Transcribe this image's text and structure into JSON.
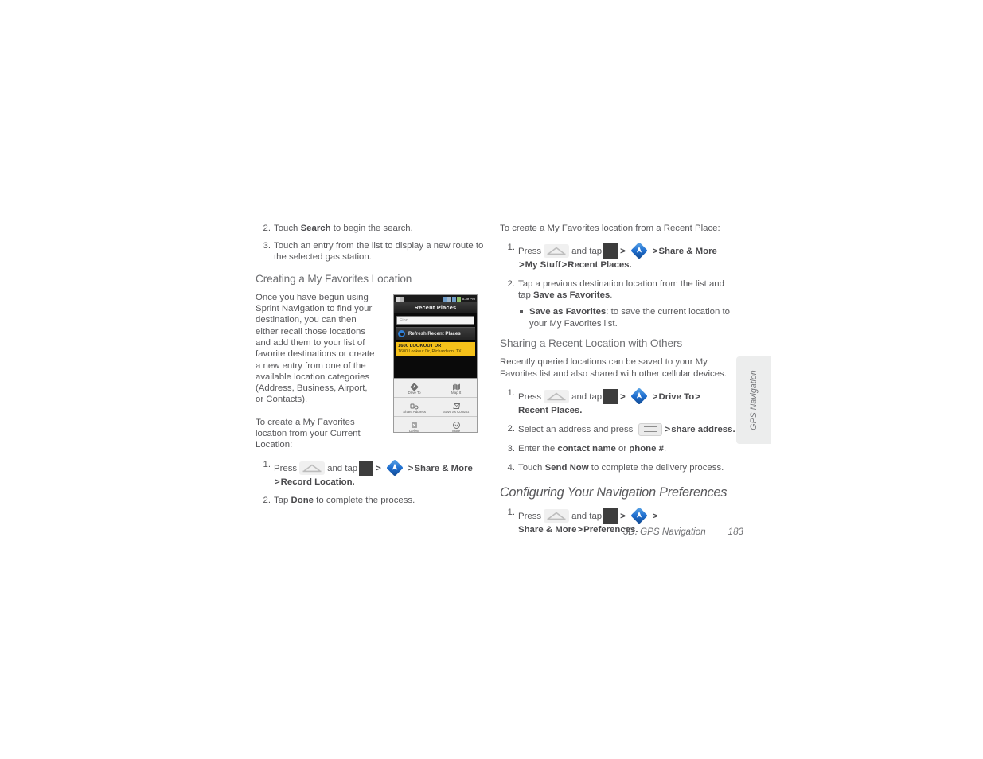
{
  "left_column": {
    "steps_top": [
      {
        "num": "2.",
        "pre": "Touch ",
        "strong": "Search",
        "post": " to begin the search."
      },
      {
        "num": "3.",
        "pre": "Touch an entry from the list to display a new route to the selected gas station.",
        "strong": "",
        "post": ""
      }
    ],
    "heading": "Creating a My Favorites Location",
    "paragraph": "Once you have begun using Sprint Navigation to find your destination, you can then either recall those locations and add them to your list of favorite destinations or create a new entry from one of the available location categories (Address, Business, Airport, or Contacts).",
    "intro2": "To create a My Favorites location from your Current Location:",
    "step1_press": "Press",
    "step1_andtap": "and tap",
    "step1_share": "Share & More",
    "step1_record": "Record Location.",
    "step2_num": "2.",
    "step2_pre": "Tap ",
    "step2_strong": "Done",
    "step2_post": " to complete the process.",
    "step1_num": "1."
  },
  "phone": {
    "status_time": "5:39 PM",
    "title": "Recent Places",
    "find_placeholder": "Find",
    "refresh_label": "Refresh Recent Places",
    "list_item_title": "1600 LOOKOUT DR",
    "list_item_sub": "1600 Lookout Dr, Richardson, TX...",
    "buttons": [
      {
        "label": "Drive To",
        "icon": "navigation-diamond-icon"
      },
      {
        "label": "Map It",
        "icon": "map-icon"
      },
      {
        "label": "Share Address",
        "icon": "share-icon"
      },
      {
        "label": "Save as Contact",
        "icon": "contact-card-icon"
      },
      {
        "label": "Delete",
        "icon": "delete-x-icon"
      },
      {
        "label": "More",
        "icon": "chevron-down-icon"
      }
    ]
  },
  "right_column": {
    "intro": "To create a My Favorites location from a Recent Place:",
    "step1_num": "1.",
    "step1_press": "Press",
    "step1_andtap": "and tap",
    "step1_share": "Share & More",
    "step1_mystuff": "My Stuff",
    "step1_recent": "Recent Places.",
    "step2_num": "2.",
    "step2_pre": "Tap a previous destination location from the list and tap ",
    "step2_strong": "Save as Favorites",
    "step2_post": ".",
    "sub_strong": "Save as Favorites",
    "sub_text": ": to save the current location to your My Favorites list.",
    "heading_sharing": "Sharing a Recent Location with Others",
    "sharing_paragraph": "Recently queried locations can be saved to your My Favorites list and also shared with other cellular devices.",
    "share_step1_num": "1.",
    "share_step1_press": "Press",
    "share_step1_andtap": "and tap",
    "share_step1_driveto": "Drive To",
    "share_step1_recent": "Recent Places.",
    "share_step2_num": "2.",
    "share_step2_pre": "Select an address and press ",
    "share_step2_share": "share address.",
    "share_step3_num": "3.",
    "share_step3_pre": "Enter the ",
    "share_step3_b1": "contact name",
    "share_step3_mid": " or ",
    "share_step3_b2": "phone #",
    "share_step3_post": ".",
    "share_step4_num": "4.",
    "share_step4_pre": "Touch ",
    "share_step4_b": "Send Now",
    "share_step4_post": " to complete the delivery process.",
    "heading_config": "Configuring Your Navigation Preferences",
    "cfg_step1_num": "1.",
    "cfg_step1_press": "Press",
    "cfg_step1_andtap": "and tap",
    "cfg_step1_share": "Share & More",
    "cfg_step1_prefs": "Preferences."
  },
  "side_tab": {
    "label": "GPS Navigation"
  },
  "footer": {
    "chapter": "3D. GPS Navigation",
    "page": "183"
  },
  "colors": {
    "highlight_yellow": "#f5c11a",
    "nav_blue": "#1f6fd0",
    "text_gray": "#58585b"
  }
}
